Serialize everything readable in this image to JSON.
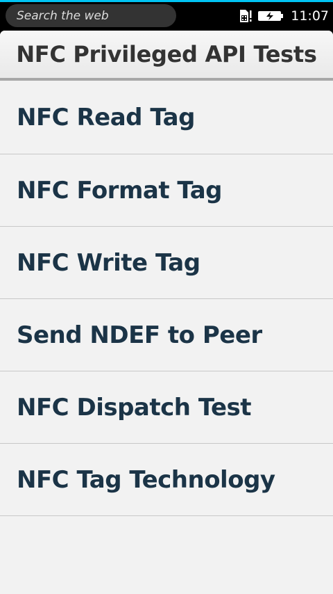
{
  "statusbar": {
    "search_placeholder": "Search the web",
    "sim_icon": "sim-card-alert-icon",
    "battery_icon": "battery-charging-icon",
    "time": "11:07",
    "accent_color": "#00c4f4"
  },
  "header": {
    "title": "NFC Privileged API Tests"
  },
  "list": {
    "items": [
      {
        "label": "NFC Read Tag"
      },
      {
        "label": "NFC Format Tag"
      },
      {
        "label": "NFC Write Tag"
      },
      {
        "label": "Send NDEF to Peer"
      },
      {
        "label": "NFC Dispatch Test"
      },
      {
        "label": "NFC Tag Technology"
      }
    ]
  },
  "colors": {
    "item_text": "#1b3447",
    "title_text": "#333333",
    "background": "#f2f2f2"
  }
}
